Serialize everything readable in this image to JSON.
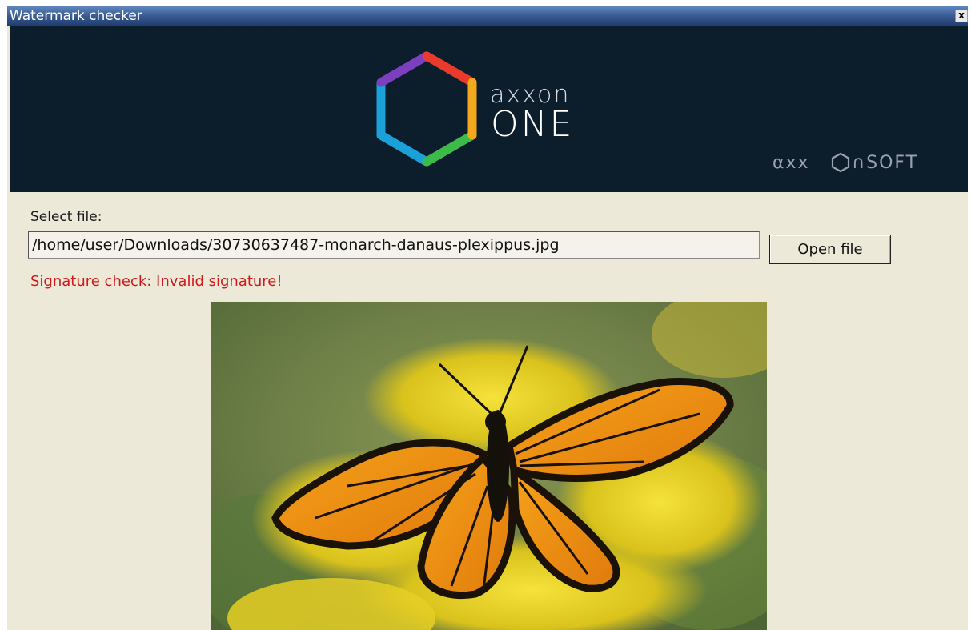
{
  "window": {
    "title": "Watermark checker",
    "close_glyph": "x"
  },
  "banner": {
    "product_line1": "axxon",
    "product_line2": "ONE",
    "company": "axxonsoft",
    "background_color": "#0c1d2c"
  },
  "form": {
    "select_label": "Select file:",
    "file_path": "/home/user/Downloads/30730637487-monarch-danaus-plexippus.jpg",
    "open_button_label": "Open file"
  },
  "status": {
    "message": "Signature check: Invalid signature!",
    "color": "#d21818"
  },
  "preview": {
    "subject": "monarch butterfly on yellow goldenrod flowers"
  },
  "icons": {
    "logo": "hexagon-logo-icon",
    "close": "close-icon"
  }
}
